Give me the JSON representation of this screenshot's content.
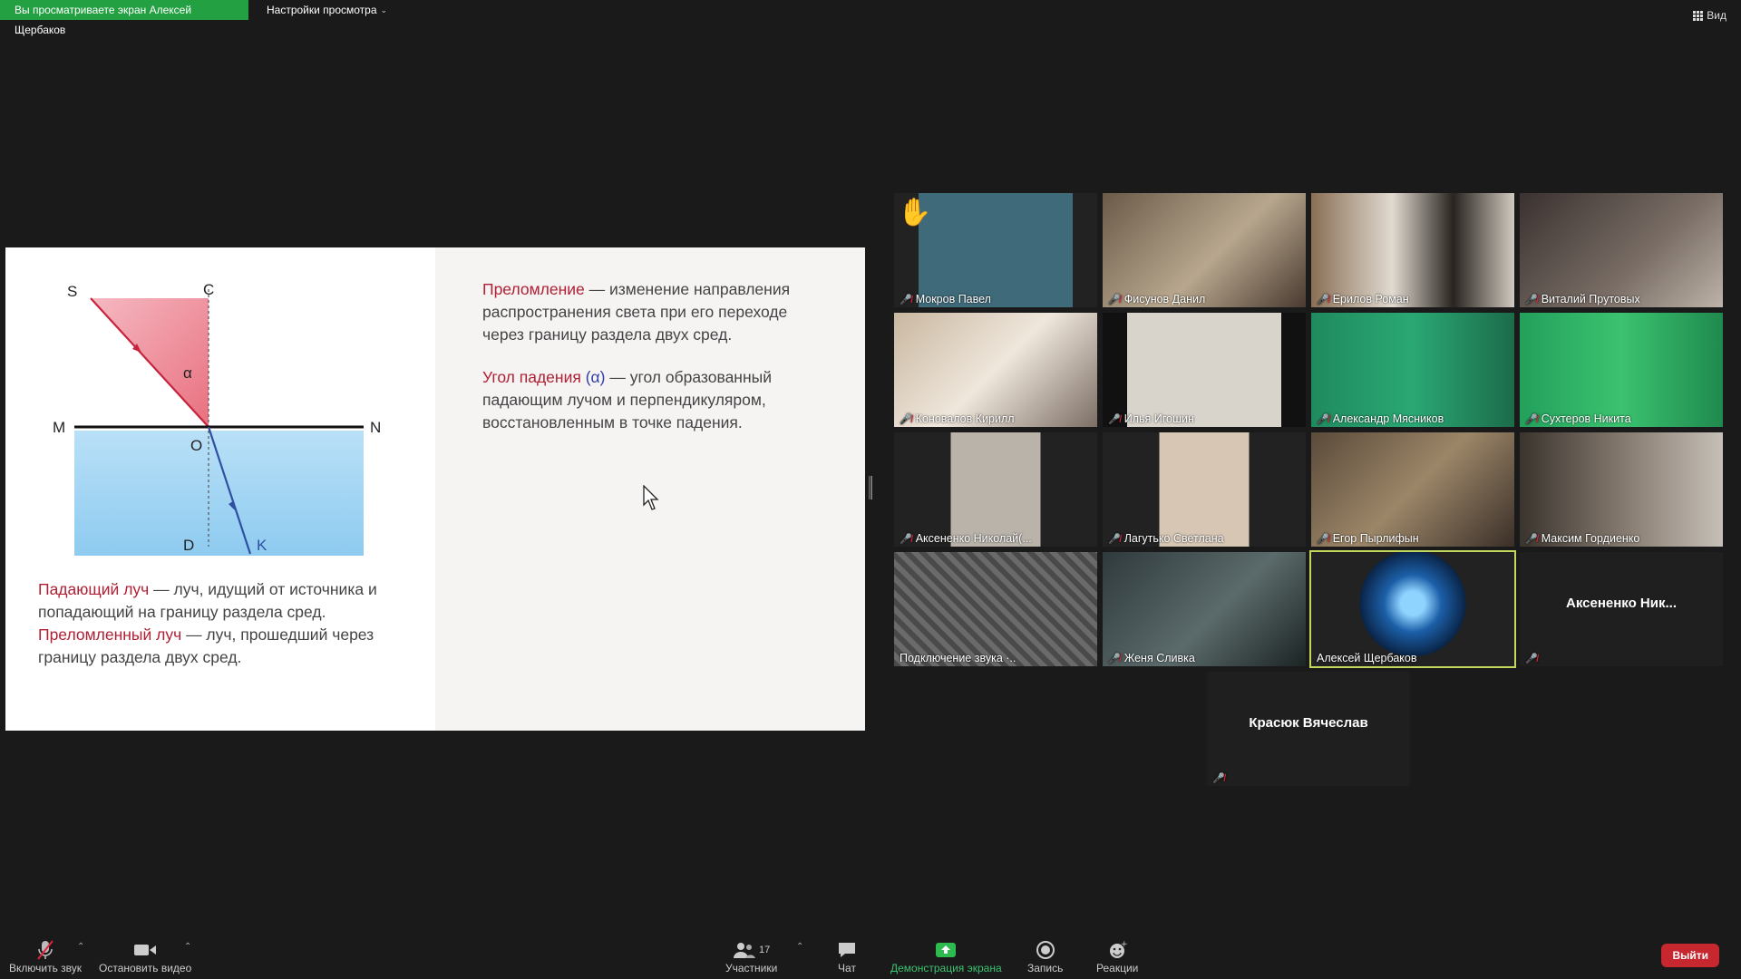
{
  "banner": {
    "viewing": "Вы просматриваете экран Алексей Щербаков",
    "view_options": "Настройки просмотра",
    "view_button": "Вид"
  },
  "slide": {
    "labels": {
      "S": "S",
      "C": "C",
      "alpha": "α",
      "M": "M",
      "N": "N",
      "O": "O",
      "D": "D",
      "K": "K"
    },
    "refraction_term": "Преломление",
    "refraction_def": " — изменение направления распространения света при его переходе через границу раздела двух сред.",
    "angle_term": "Угол падения",
    "angle_symbol": "(α)",
    "angle_def": " — угол образованный падающим лучом и перпендикуляром, восстановленным в точке падения.",
    "incident_term": "Падающий луч",
    "incident_def": " — луч, идущий от источника и попадающий на границу раздела сред.",
    "refracted_term": "Преломленный луч",
    "refracted_def": " — луч, прошедший через  границу раздела двух сред."
  },
  "participants": [
    {
      "name": "Мокров Павел",
      "muted": true,
      "hand": true
    },
    {
      "name": "Фисунов Данил",
      "muted": true
    },
    {
      "name": "Ерилов Роман",
      "muted": true
    },
    {
      "name": "Виталий Прутовых",
      "muted": true
    },
    {
      "name": "Коновалов Кирилл",
      "muted": true
    },
    {
      "name": "Илья Игошин",
      "muted": true
    },
    {
      "name": "Александр Мясников",
      "muted": true
    },
    {
      "name": "Сухтеров Никита",
      "muted": true
    },
    {
      "name": "Аксененко Николай(...",
      "muted": true
    },
    {
      "name": "Лагутько Светлана",
      "muted": true
    },
    {
      "name": "Егор Пырлифын",
      "muted": true
    },
    {
      "name": "Максим Гордиенко",
      "muted": true
    },
    {
      "name": "Подключение звука ·..",
      "muted": false
    },
    {
      "name": "Женя Сливка",
      "muted": true
    },
    {
      "name": "Алексей Щербаков",
      "muted": false,
      "active": true
    },
    {
      "name": "Аксененко  Ник...",
      "muted": true,
      "blank": true
    },
    {
      "name": "Красюк Вячеслав",
      "muted": true,
      "blank": true
    }
  ],
  "toolbar": {
    "unmute": "Включить звук",
    "stop_video": "Остановить видео",
    "participants": "Участники",
    "participants_count": "17",
    "chat": "Чат",
    "share": "Демонстрация экрана",
    "record": "Запись",
    "reactions": "Реакции",
    "leave": "Выйти"
  },
  "colors": {
    "accent_green": "#23a042",
    "share_green": "#2dbb4f",
    "leave_red": "#c7282f",
    "active_border": "#c2d85a"
  }
}
